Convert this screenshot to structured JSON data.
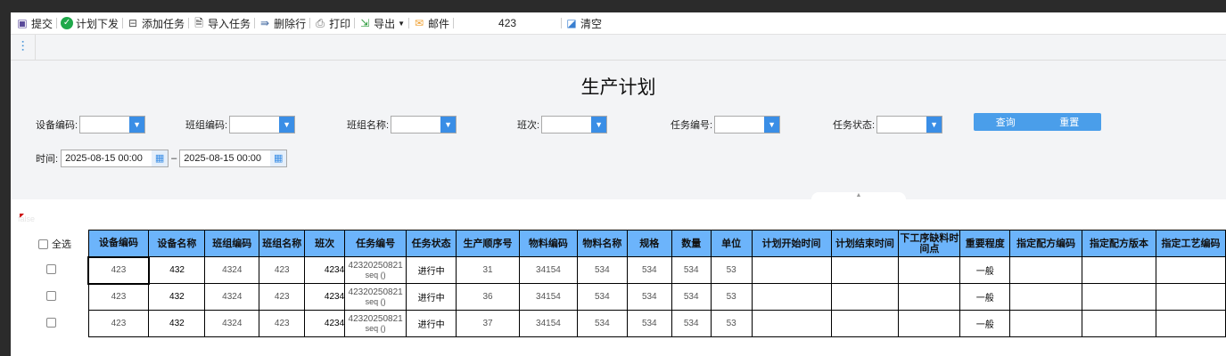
{
  "toolbar": {
    "submit": "提交",
    "dispatch": "计划下发",
    "add_task": "添加任务",
    "import_task": "导入任务",
    "delete_row": "删除行",
    "print": "打印",
    "export": "导出",
    "mail": "邮件",
    "value": "423",
    "clear": "清空"
  },
  "page_title": "生产计划",
  "filters": {
    "device_code": "设备编码:",
    "team_code": "班组编码:",
    "team_name": "班组名称:",
    "shift": "班次:",
    "task_no": "任务编号:",
    "task_status": "任务状态:",
    "query": "查询",
    "reset": "重置",
    "time": "时间:",
    "time_from": "2025-08-15 00:00",
    "time_to": "2025-08-15 00:00",
    "dash": "–"
  },
  "debug_text": "false",
  "select_all": "全选",
  "columns": [
    "设备编码",
    "设备名称",
    "班组编码",
    "班组名称",
    "班次",
    "任务编号",
    "任务状态",
    "生产顺序号",
    "物料编码",
    "物料名称",
    "规格",
    "数量",
    "单位",
    "计划开始时间",
    "计划结束时间",
    "下工序缺料时间点",
    "重要程度",
    "指定配方编码",
    "指定配方版本",
    "指定工艺编码"
  ],
  "rows": [
    {
      "device_code": "423",
      "device_name": "432",
      "team_code": "4324",
      "team_name": "423",
      "shift": "4234",
      "task_no": "42320250821",
      "task_seq": "seq ()",
      "status": "进行中",
      "seq": "31",
      "material_code": "34154",
      "material_name": "534",
      "spec": "534",
      "qty": "534",
      "unit": "53",
      "importance": "一般"
    },
    {
      "device_code": "423",
      "device_name": "432",
      "team_code": "4324",
      "team_name": "423",
      "shift": "4234",
      "task_no": "42320250821",
      "task_seq": "seq ()",
      "status": "进行中",
      "seq": "36",
      "material_code": "34154",
      "material_name": "534",
      "spec": "534",
      "qty": "534",
      "unit": "53",
      "importance": "一般"
    },
    {
      "device_code": "423",
      "device_name": "432",
      "team_code": "4324",
      "team_name": "423",
      "shift": "4234",
      "task_no": "42320250821",
      "task_seq": "seq ()",
      "status": "进行中",
      "seq": "37",
      "material_code": "34154",
      "material_name": "534",
      "spec": "534",
      "qty": "534",
      "unit": "53",
      "importance": "一般"
    }
  ]
}
